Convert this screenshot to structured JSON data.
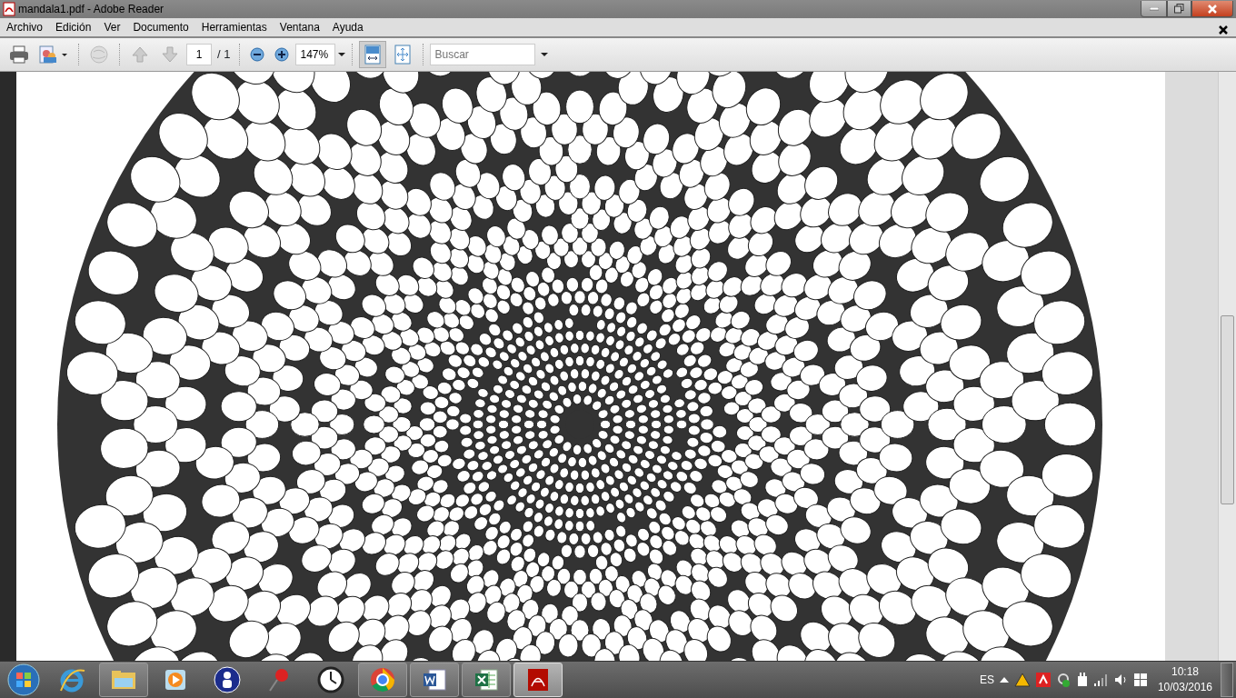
{
  "window": {
    "title": "mandala1.pdf - Adobe Reader"
  },
  "menu": [
    "Archivo",
    "Edición",
    "Ver",
    "Documento",
    "Herramientas",
    "Ventana",
    "Ayuda"
  ],
  "toolbar": {
    "page": "1",
    "page_total": "/ 1",
    "zoom": "147%",
    "search": {
      "placeholder": "Buscar"
    },
    "fit_width_selected": true,
    "fit_page_selected": false
  },
  "taskbar": {
    "items": [
      {
        "kind": "ie",
        "running": false,
        "selected": false
      },
      {
        "kind": "folder",
        "running": true,
        "selected": false
      },
      {
        "kind": "media",
        "running": false,
        "selected": false
      },
      {
        "kind": "person",
        "running": false,
        "selected": false
      },
      {
        "kind": "pin",
        "running": false,
        "selected": false
      },
      {
        "kind": "clock",
        "running": false,
        "selected": false
      },
      {
        "kind": "chrome",
        "running": true,
        "selected": false
      },
      {
        "kind": "word",
        "running": true,
        "selected": false
      },
      {
        "kind": "excel",
        "running": true,
        "selected": false
      },
      {
        "kind": "pdf",
        "running": true,
        "selected": true
      }
    ],
    "language": "ES",
    "time": "10:18",
    "date": "10/03/2016"
  }
}
